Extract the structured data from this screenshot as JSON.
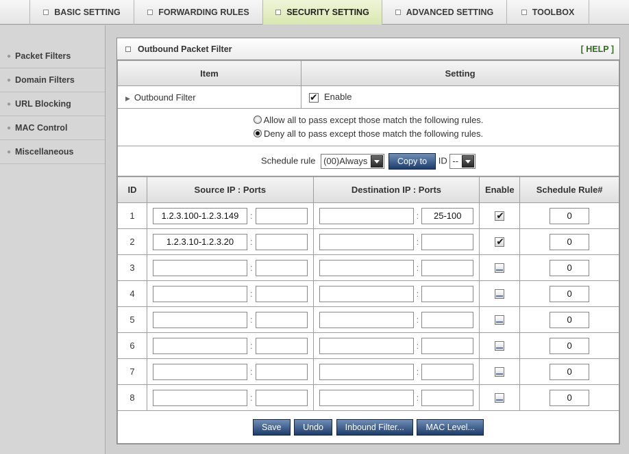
{
  "nav": {
    "tabs": [
      {
        "label": "BASIC SETTING"
      },
      {
        "label": "FORWARDING RULES"
      },
      {
        "label": "SECURITY SETTING"
      },
      {
        "label": "ADVANCED SETTING"
      },
      {
        "label": "TOOLBOX"
      }
    ],
    "active_tab": "SECURITY SETTING"
  },
  "sidebar": {
    "items": [
      {
        "label": "Packet Filters"
      },
      {
        "label": "Domain Filters"
      },
      {
        "label": "URL Blocking"
      },
      {
        "label": "MAC Control"
      },
      {
        "label": "Miscellaneous"
      }
    ]
  },
  "panel": {
    "title": "Outbound Packet Filter",
    "help": "[ HELP ]",
    "col_item": "Item",
    "col_setting": "Setting",
    "filter_label": "Outbound Filter",
    "filter_enable_label": "Enable",
    "filter_enabled": true,
    "radio_allow": "Allow all to pass except those match the following rules.",
    "radio_deny": "Deny all to pass except those match the following rules.",
    "selected_policy": "deny",
    "schedule_label": "Schedule rule",
    "schedule_value": "(00)Always",
    "copy_to_label": "Copy to",
    "id_label": "ID",
    "id_value": "--"
  },
  "grid": {
    "headers": {
      "id": "ID",
      "source": "Source IP : Ports",
      "destination": "Destination IP : Ports",
      "enable": "Enable",
      "schedule": "Schedule Rule#"
    },
    "rows": [
      {
        "id": "1",
        "src_ip": "1.2.3.100-1.2.3.149",
        "src_port": "",
        "dst_ip": "",
        "dst_port": "25-100",
        "enabled": true,
        "schedule": "0"
      },
      {
        "id": "2",
        "src_ip": "1.2.3.10-1.2.3.20",
        "src_port": "",
        "dst_ip": "",
        "dst_port": "",
        "enabled": true,
        "schedule": "0"
      },
      {
        "id": "3",
        "src_ip": "",
        "src_port": "",
        "dst_ip": "",
        "dst_port": "",
        "enabled": false,
        "schedule": "0"
      },
      {
        "id": "4",
        "src_ip": "",
        "src_port": "",
        "dst_ip": "",
        "dst_port": "",
        "enabled": false,
        "schedule": "0"
      },
      {
        "id": "5",
        "src_ip": "",
        "src_port": "",
        "dst_ip": "",
        "dst_port": "",
        "enabled": false,
        "schedule": "0"
      },
      {
        "id": "6",
        "src_ip": "",
        "src_port": "",
        "dst_ip": "",
        "dst_port": "",
        "enabled": false,
        "schedule": "0"
      },
      {
        "id": "7",
        "src_ip": "",
        "src_port": "",
        "dst_ip": "",
        "dst_port": "",
        "enabled": false,
        "schedule": "0"
      },
      {
        "id": "8",
        "src_ip": "",
        "src_port": "",
        "dst_ip": "",
        "dst_port": "",
        "enabled": false,
        "schedule": "0"
      }
    ]
  },
  "footer": {
    "save": "Save",
    "undo": "Undo",
    "inbound": "Inbound Filter...",
    "mac_level": "MAC Level..."
  }
}
